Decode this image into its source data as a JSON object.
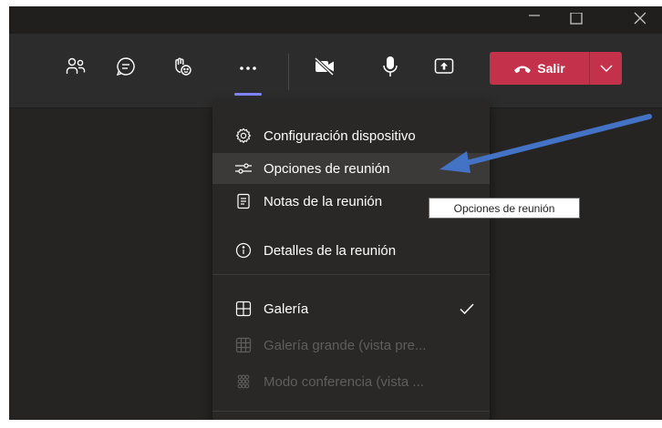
{
  "titlebar": {
    "minimize_icon": "minimize-icon",
    "maximize_icon": "maximize-icon",
    "close_icon": "close-icon"
  },
  "toolbar": {
    "icons": [
      "participants-icon",
      "chat-icon",
      "raise-hand-icon",
      "more-actions-icon",
      "camera-off-icon",
      "microphone-icon",
      "share-screen-icon"
    ],
    "leave_label": "Salir",
    "leave_color": "#c4314b"
  },
  "menu": {
    "items": [
      {
        "label": "Configuración dispositivo",
        "icon": "gear-icon"
      },
      {
        "label": "Opciones de reunión",
        "icon": "sliders-icon"
      },
      {
        "label": "Notas de la reunión",
        "icon": "notes-icon"
      },
      {
        "label": "Detalles de la reunión",
        "icon": "info-icon"
      },
      {
        "label": "Galería",
        "icon": "gallery-icon",
        "checked": true
      },
      {
        "label": "Galería grande (vista pre...",
        "icon": "large-gallery-icon",
        "disabled": true
      },
      {
        "label": "Modo conferencia (vista ...",
        "icon": "together-mode-icon",
        "disabled": true
      }
    ]
  },
  "tooltip": {
    "text": "Opciones de reunión"
  },
  "colors": {
    "accent": "#7f85f5",
    "arrow": "#4472c4",
    "background": "#252423"
  }
}
